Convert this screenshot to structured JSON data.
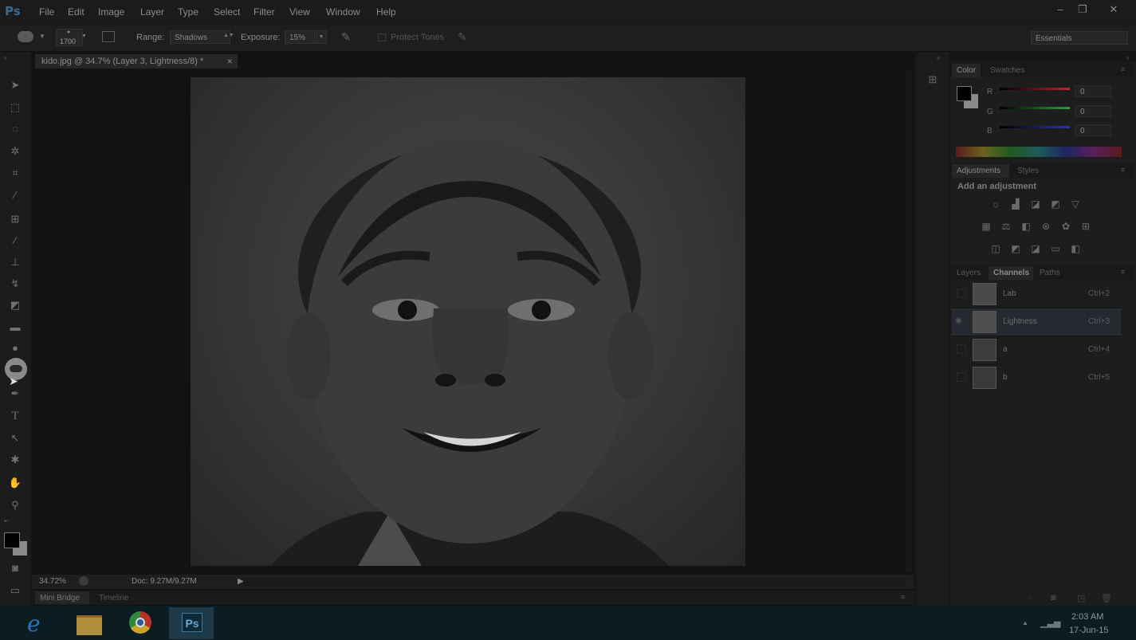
{
  "app": {
    "logo": "Ps"
  },
  "menu": [
    "File",
    "Edit",
    "Image",
    "Layer",
    "Type",
    "Select",
    "Filter",
    "View",
    "Window",
    "Help"
  ],
  "window_controls": {
    "minimize": "–",
    "restore": "❐",
    "close": "✕"
  },
  "options": {
    "brush_size": "1700",
    "range_label": "Range:",
    "range_value": "Shadows",
    "exposure_label": "Exposure:",
    "exposure_value": "15%",
    "protect_tones": "Protect Tones",
    "workspace": "Essentials"
  },
  "document": {
    "tab_title": "kido.jpg @ 34.7% (Layer 3, Lightness/8) *",
    "zoom": "34.72%",
    "doc_size": "Doc: 9.27M/9.27M"
  },
  "bottom_tabs": [
    "Mini Bridge",
    "Timeline"
  ],
  "color_panel": {
    "tabs": [
      "Color",
      "Swatches"
    ],
    "channels": [
      {
        "label": "R",
        "value": "0",
        "color": "#c0232b"
      },
      {
        "label": "G",
        "value": "0",
        "color": "#27a339"
      },
      {
        "label": "B",
        "value": "0",
        "color": "#2735b0"
      }
    ]
  },
  "adjustments_panel": {
    "tabs": [
      "Adjustments",
      "Styles"
    ],
    "heading": "Add an adjustment"
  },
  "layers_panel": {
    "tabs": [
      "Layers",
      "Channels",
      "Paths"
    ],
    "channels": [
      {
        "name": "Lab",
        "shortcut": "Ctrl+2"
      },
      {
        "name": "Lightness",
        "shortcut": "Ctrl+3"
      },
      {
        "name": "a",
        "shortcut": "Ctrl+4"
      },
      {
        "name": "b",
        "shortcut": "Ctrl+5"
      }
    ]
  },
  "taskbar": {
    "time": "2:03 AM",
    "date": "17-Jun-15",
    "apps": [
      "internet-explorer",
      "file-explorer",
      "chrome",
      "photoshop"
    ]
  }
}
